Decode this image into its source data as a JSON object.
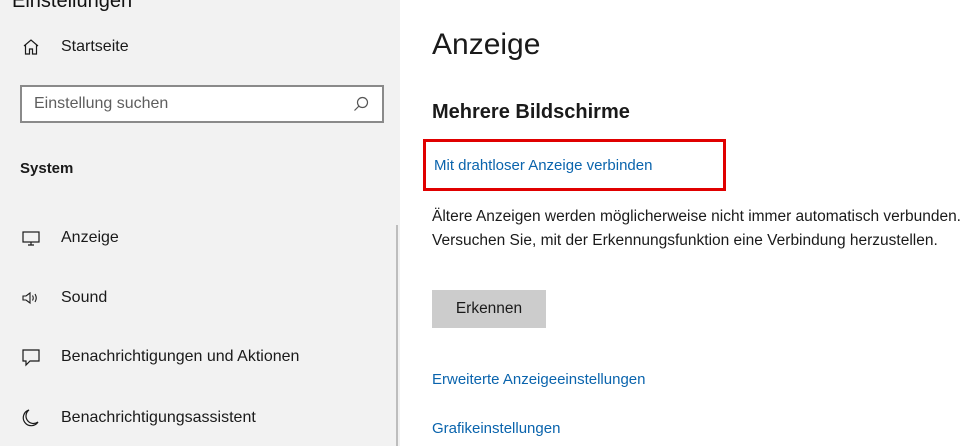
{
  "window": {
    "title_fragment": "Einstellungen"
  },
  "sidebar": {
    "home_label": "Startseite",
    "search": {
      "placeholder": "Einstellung suchen",
      "value": ""
    },
    "section_header": "System",
    "items": [
      {
        "label": "Anzeige",
        "icon": "monitor-icon"
      },
      {
        "label": "Sound",
        "icon": "speaker-icon"
      },
      {
        "label": "Benachrichtigungen und Aktionen",
        "icon": "notification-icon"
      },
      {
        "label": "Benachrichtigungsassistent",
        "icon": "moon-icon"
      }
    ]
  },
  "main": {
    "title": "Anzeige",
    "subtitle": "Mehrere Bildschirme",
    "wireless_link": "Mit drahtloser Anzeige verbinden",
    "description": "Ältere Anzeigen werden möglicherweise nicht immer automatisch verbunden. Versuchen Sie, mit der Erkennungsfunktion eine Verbindung herzustellen.",
    "detect_button": "Erkennen",
    "advanced_link": "Erweiterte Anzeigeeinstellungen",
    "graphics_link": "Grafikeinstellungen"
  },
  "colors": {
    "sidebar_bg": "#f2f2f2",
    "link": "#0a64ad",
    "highlight": "#e00000",
    "button_bg": "#cccccc"
  }
}
